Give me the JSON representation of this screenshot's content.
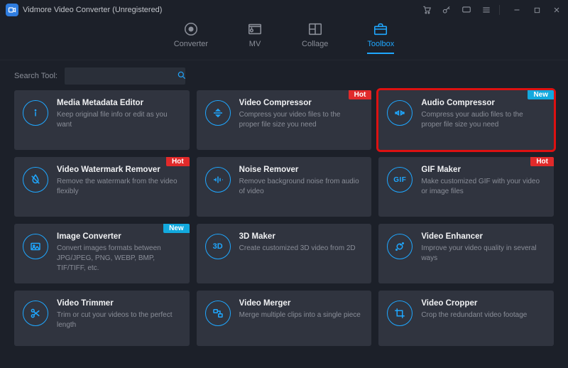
{
  "app": {
    "title": "Vidmore Video Converter (Unregistered)"
  },
  "tabs": [
    {
      "id": "converter",
      "label": "Converter"
    },
    {
      "id": "mv",
      "label": "MV"
    },
    {
      "id": "collage",
      "label": "Collage"
    },
    {
      "id": "toolbox",
      "label": "Toolbox"
    }
  ],
  "active_tab": "toolbox",
  "search": {
    "label": "Search Tool:",
    "value": ""
  },
  "badges": {
    "hot": "Hot",
    "new": "New"
  },
  "tools": [
    {
      "title": "Media Metadata Editor",
      "desc": "Keep original file info or edit as you want"
    },
    {
      "title": "Video Compressor",
      "desc": "Compress your video files to the proper file size you need",
      "badge": "hot"
    },
    {
      "title": "Audio Compressor",
      "desc": "Compress your audio files to the proper file size you need",
      "badge": "new",
      "highlight": true
    },
    {
      "title": "Video Watermark Remover",
      "desc": "Remove the watermark from the video flexibly",
      "badge": "hot"
    },
    {
      "title": "Noise Remover",
      "desc": "Remove background noise from audio of video"
    },
    {
      "title": "GIF Maker",
      "desc": "Make customized GIF with your video or image files",
      "badge": "hot"
    },
    {
      "title": "Image Converter",
      "desc": "Convert images formats between JPG/JPEG, PNG, WEBP, BMP, TIF/TIFF, etc.",
      "badge": "new"
    },
    {
      "title": "3D Maker",
      "desc": "Create customized 3D video from 2D"
    },
    {
      "title": "Video Enhancer",
      "desc": "Improve your video quality in several ways"
    },
    {
      "title": "Video Trimmer",
      "desc": "Trim or cut your videos to the perfect length"
    },
    {
      "title": "Video Merger",
      "desc": "Merge multiple clips into a single piece"
    },
    {
      "title": "Video Cropper",
      "desc": "Crop the redundant video footage"
    }
  ]
}
